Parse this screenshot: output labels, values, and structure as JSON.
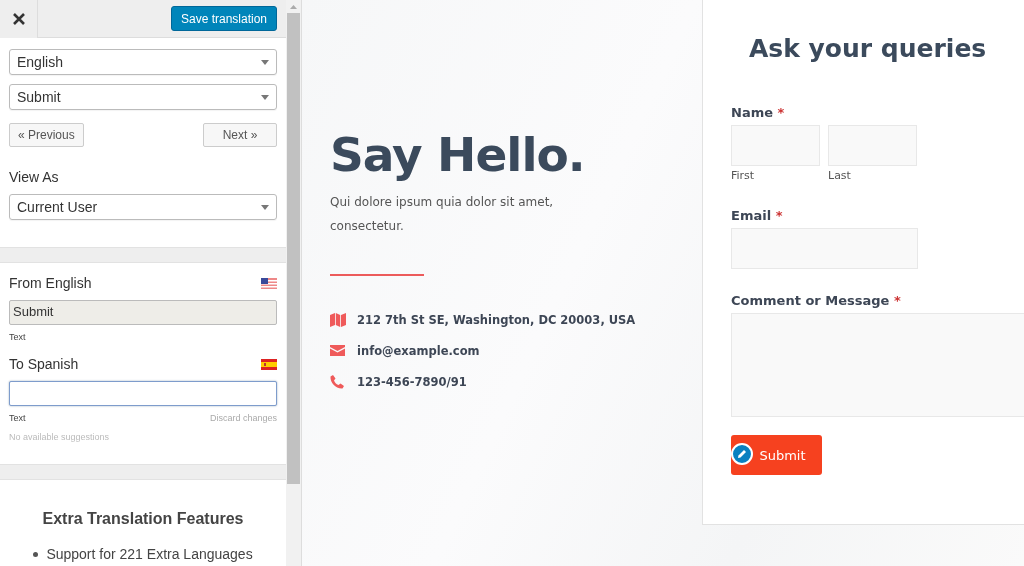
{
  "sidebar": {
    "save_button": "Save translation",
    "language_select": "English",
    "string_select": "Submit",
    "prev_button": "« Previous",
    "next_button": "Next »",
    "view_as": {
      "label": "View As",
      "value": "Current User"
    },
    "source": {
      "label": "From English",
      "kind": "us",
      "value": "Submit",
      "type_label": "Text"
    },
    "target": {
      "label": "To Spanish",
      "kind": "es",
      "type_label": "Text",
      "discard": "Discard changes",
      "suggestions": "No available suggestions"
    },
    "promo": {
      "title": "Extra Translation Features",
      "items": [
        "Support for 221 Extra Languages"
      ]
    }
  },
  "contact": {
    "heading": "Say Hello.",
    "intro": "Qui dolore ipsum quia dolor sit amet, consectetur.",
    "items": [
      {
        "kind": "address",
        "text": "212 7th St SE, Washington, DC 20003, USA"
      },
      {
        "kind": "email",
        "text": "info@example.com"
      },
      {
        "kind": "phone",
        "text": "123-456-7890/91"
      }
    ]
  },
  "form": {
    "title": "Ask your queries",
    "fields": [
      {
        "kind": "name",
        "label": "Name",
        "required_mark": "*",
        "sublabels": [
          "First",
          "Last"
        ]
      },
      {
        "kind": "email",
        "label": "Email",
        "required_mark": "*"
      },
      {
        "kind": "textarea",
        "label": "Comment or Message",
        "required_mark": "*"
      }
    ],
    "submit": "Submit"
  }
}
